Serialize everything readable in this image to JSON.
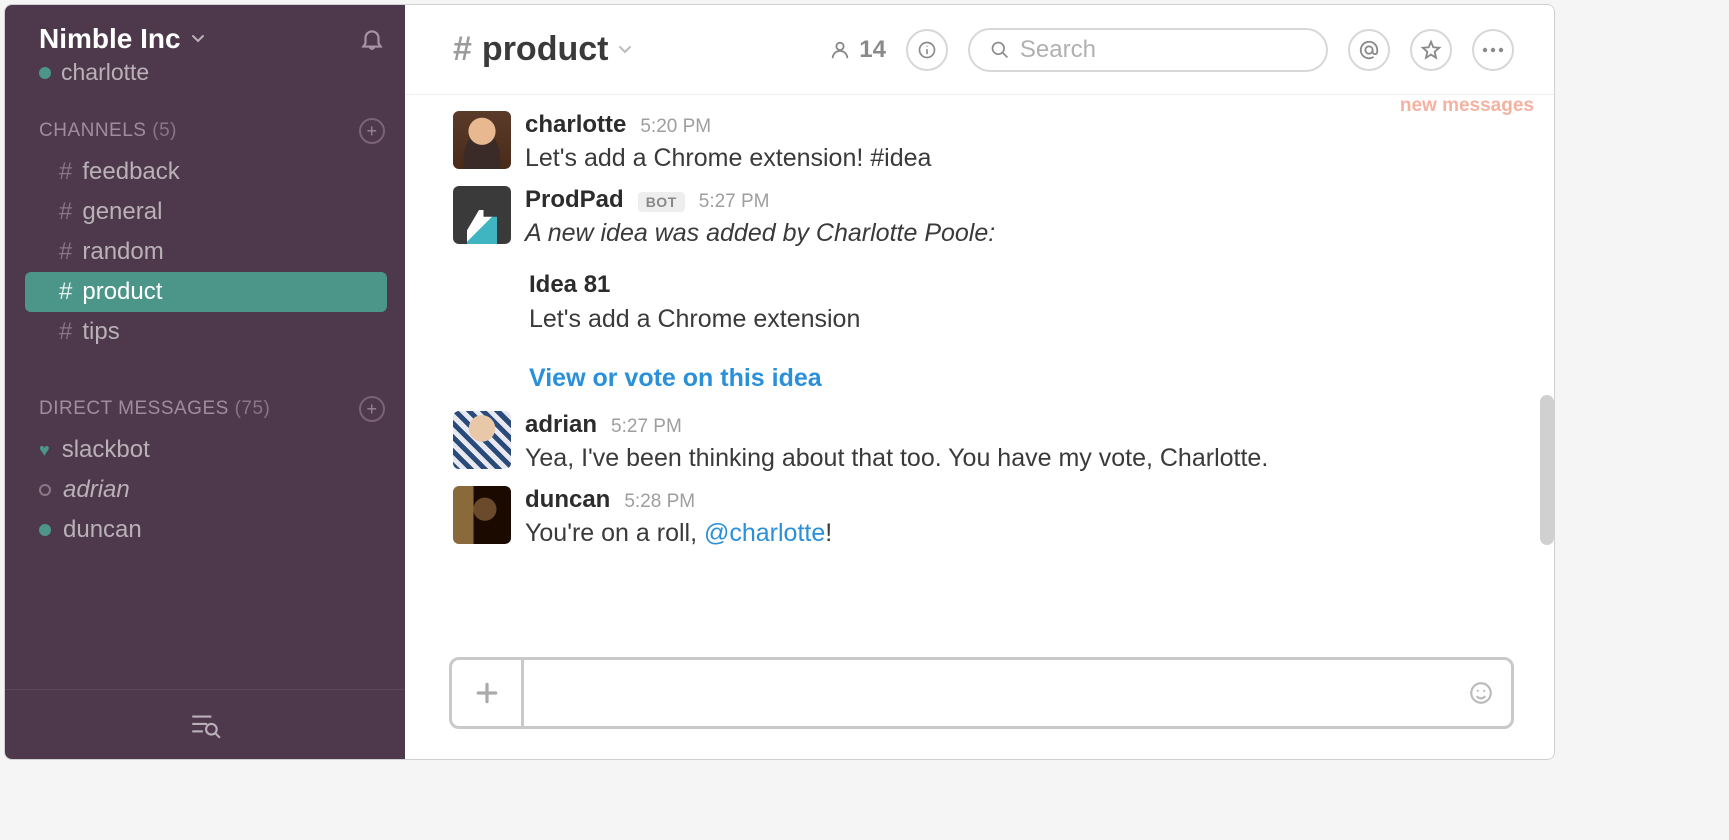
{
  "team": {
    "name": "Nimble Inc",
    "current_user": "charlotte"
  },
  "sidebar": {
    "channels_header": "CHANNELS",
    "channels_count": "(5)",
    "channels": [
      {
        "name": "feedback",
        "active": false
      },
      {
        "name": "general",
        "active": false
      },
      {
        "name": "random",
        "active": false
      },
      {
        "name": "product",
        "active": true
      },
      {
        "name": "tips",
        "active": false
      }
    ],
    "dms_header": "DIRECT MESSAGES",
    "dms_count": "(75)",
    "dms": [
      {
        "name": "slackbot",
        "presence": "heart"
      },
      {
        "name": "adrian",
        "presence": "away",
        "italic": true
      },
      {
        "name": "duncan",
        "presence": "online"
      }
    ]
  },
  "header": {
    "channel": "product",
    "member_count": "14",
    "search_placeholder": "Search"
  },
  "new_messages_label": "new messages",
  "messages": [
    {
      "user": "charlotte",
      "time": "5:20 PM",
      "text": "Let's add a Chrome extension! #idea",
      "avatar": "charlotte"
    },
    {
      "user": "ProdPad",
      "is_bot": true,
      "bot_label": "BOT",
      "time": "5:27 PM",
      "italic_text": "A new idea was added by Charlotte Poole:",
      "avatar": "prodpad",
      "attachment": {
        "title": "Idea 81",
        "desc": "Let's add a Chrome extension",
        "link_text": "View or vote on this idea"
      }
    },
    {
      "user": "adrian",
      "time": "5:27 PM",
      "text": "Yea, I've been thinking about that too. You have my vote, Charlotte.",
      "avatar": "adrian"
    },
    {
      "user": "duncan",
      "time": "5:28 PM",
      "text_pre": "You're on a roll, ",
      "mention": "@charlotte",
      "text_post": "!",
      "avatar": "duncan"
    }
  ],
  "composer": {
    "value": ""
  },
  "colors": {
    "sidebar_bg": "#4d394b",
    "active_bg": "#4c9689",
    "link": "#2a90d9"
  }
}
